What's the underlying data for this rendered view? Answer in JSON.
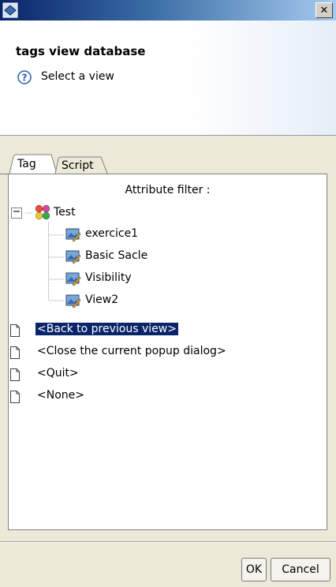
{
  "window": {
    "close_glyph": "✕"
  },
  "header": {
    "title": "tags view database",
    "message": "Select a view"
  },
  "tabs": [
    {
      "label": "Tag",
      "selected": true
    },
    {
      "label": "Script",
      "selected": false
    }
  ],
  "panel": {
    "filter_label": "Attribute filter :",
    "tree": {
      "root": {
        "label": "Test",
        "expanded": true,
        "toggle_glyph": "−"
      },
      "children": [
        "exercice1",
        "Basic Sacle",
        "Visibility",
        "View2"
      ]
    },
    "actions": [
      {
        "label": "<Back to previous view>",
        "selected": true
      },
      {
        "label": "<Close the current popup dialog>",
        "selected": false
      },
      {
        "label": "<Quit>",
        "selected": false
      },
      {
        "label": "<None>",
        "selected": false
      }
    ]
  },
  "buttons": {
    "ok": "OK",
    "cancel": "Cancel"
  },
  "colors": {
    "selection": "#0a246a",
    "titlebar": "#0a246a",
    "dialog_bg": "#ece9d8"
  }
}
